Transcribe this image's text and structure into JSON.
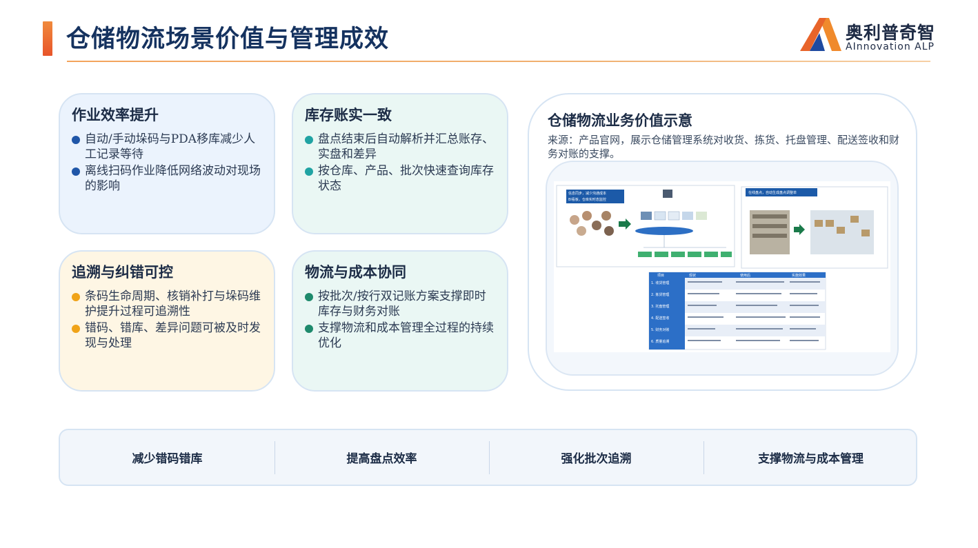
{
  "header": {
    "title": "仓储物流场景价值与管理成效",
    "logo_name": "奥利普奇智",
    "logo_sub": "AInnovation ALP"
  },
  "cards": [
    {
      "title": "作业效率提升",
      "points": [
        "自动/手动垛码与PDA移库减少人工记录等待",
        "离线扫码作业降低网络波动对现场的影响"
      ]
    },
    {
      "title": "库存账实一致",
      "points": [
        "盘点结束后自动解析并汇总账存、实盘和差异",
        "按仓库、产品、批次快速查询库存状态"
      ]
    },
    {
      "title": "追溯与纠错可控",
      "points": [
        "条码生命周期、核销补打与垛码维护提升过程可追溯性",
        "错码、错库、差异问题可被及时发现与处理"
      ]
    },
    {
      "title": "物流与成本协同",
      "points": [
        "按批次/按行双记账方案支撑即时库存与财务对账",
        "支撑物流和成本管理全过程的持续优化"
      ]
    }
  ],
  "value_panel": {
    "title": "仓储物流业务价值示意",
    "source": "来源：产品官网，展示仓储管理系统对收货、拣货、托盘管理、配送签收和财务对账的支撑。",
    "image": {
      "left_banner": "信息同步，减少沟通成本",
      "left_banner2": "BI看板，仓库实时态监控",
      "right_banner": "在线盘点，自动生成盘点调整单",
      "table_headers": [
        "项目",
        "现状",
        "使用后",
        "实施效果"
      ],
      "table_rows": [
        "1. 收货管理",
        "2. 拣货管理",
        "3. 托盘管理",
        "4. 配送签收",
        "5. 财务对账",
        "6. 质量追溯"
      ]
    }
  },
  "summary": [
    "减少错码错库",
    "提高盘点效率",
    "强化批次追溯",
    "支撑物流与成本管理"
  ],
  "colors": {
    "title": "#15325f",
    "accent": "#e8642a",
    "dot_blue": "#1f56a8",
    "dot_teal": "#20a3a3",
    "dot_orange": "#f0a318",
    "dot_green": "#1e8a6c"
  }
}
